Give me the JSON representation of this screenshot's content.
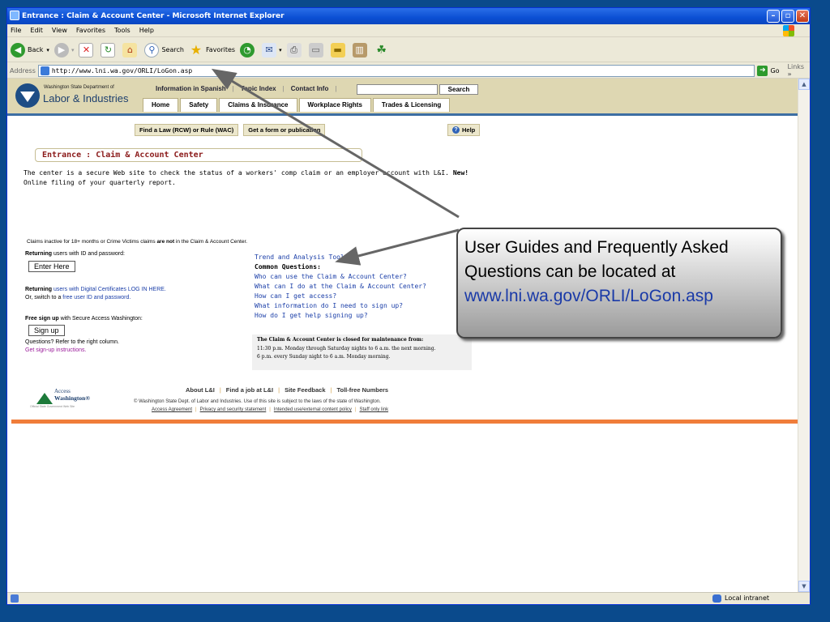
{
  "window": {
    "title": "Entrance : Claim & Account Center - Microsoft Internet Explorer",
    "controls": {
      "minimize": "–",
      "maximize": "▫",
      "close": "✕"
    }
  },
  "menu": [
    "File",
    "Edit",
    "View",
    "Favorites",
    "Tools",
    "Help"
  ],
  "toolbar": {
    "back": "Back",
    "search": "Search",
    "favorites": "Favorites"
  },
  "address_bar": {
    "label": "Address",
    "url": "http://www.lni.wa.gov/ORLI/LoGon.asp",
    "go": "Go",
    "links": "Links",
    "links_chevron": "»"
  },
  "status_bar": {
    "zone": "Local intranet"
  },
  "header": {
    "dept": "Washington State Department of",
    "name": "Labor & Industries",
    "top_links": [
      "Information in Spanish",
      "Topic Index",
      "Contact Info"
    ],
    "search_button": "Search",
    "tabs": [
      "Home",
      "Safety",
      "Claims & Insurance",
      "Workplace Rights",
      "Trades & Licensing"
    ]
  },
  "subnav": {
    "law": "Find a Law (RCW) or Rule (WAC)",
    "form": "Get a form or publication",
    "help": "Help",
    "help_icon": "?"
  },
  "page": {
    "title": "Entrance : Claim & Account Center",
    "intro_1": "The center is a secure Web site to check the status of a workers' comp claim or an employer account with L&I.",
    "intro_new": "New!",
    "intro_2": "Online filing of your quarterly report.",
    "inactive_note_a": "Claims inactive for 18+ months or Crime Victims claims ",
    "inactive_note_b": "are not",
    "inactive_note_c": " in the Claim & Account Center."
  },
  "left_col": {
    "returning_bold": "Returning",
    "returning_text": " users with ID and password:",
    "enter_here": "Enter Here",
    "returning2_bold": "Returning",
    "returning2_link": " users with Digital Certificates LOG IN HERE.",
    "switch_text": "Or, switch to a ",
    "switch_link": "free user ID and password.",
    "free_bold": "Free sign up",
    "free_text": " with Secure Access Washington:",
    "sign_up": "Sign up",
    "questions": "Questions? Refer to the right column.",
    "instructions": "Get sign-up instructions."
  },
  "right_col": {
    "trend": "Trend and Analysis Tools",
    "common": "Common Questions:",
    "q1": "Who can use the Claim & Account Center?",
    "q2": "What can I do at the Claim & Account Center?",
    "q3": "How can I get access?",
    "q4": "What information do I need to sign up?",
    "q5": "How do I get help signing up?"
  },
  "maintenance": {
    "title": "The Claim & Account Center is closed for maintenance from:",
    "line1": "11:30 p.m. Monday through Saturday nights to 6 a.m. the next morning.",
    "line2": "6 p.m. every Sunday night to 6 a.m. Monday morning."
  },
  "footer": {
    "links": [
      "About L&I",
      "Find a job at L&I",
      "Site Feedback",
      "Toll-free Numbers"
    ],
    "copyright": "© Washington State Dept. of Labor and Industries. Use of this site is subject to the laws of the state of Washington.",
    "policy": [
      "Access Agreement",
      "Privacy and security statement",
      "Intended use/external content policy",
      "Staff only link"
    ],
    "aw_line1": "Access",
    "aw_line2": "Washington®",
    "aw_line3": "Official State Government Web Site"
  },
  "callout": {
    "text": "User Guides and Frequently Asked Questions can be located at",
    "url": "www.lni.wa.gov/ORLI/LoGon.asp"
  },
  "colors": {
    "slide_bg": "#0a4a8c",
    "callout_url": "#1a3aa8",
    "title_red": "#8b1a1a",
    "orange_rule": "#f07d3a"
  }
}
